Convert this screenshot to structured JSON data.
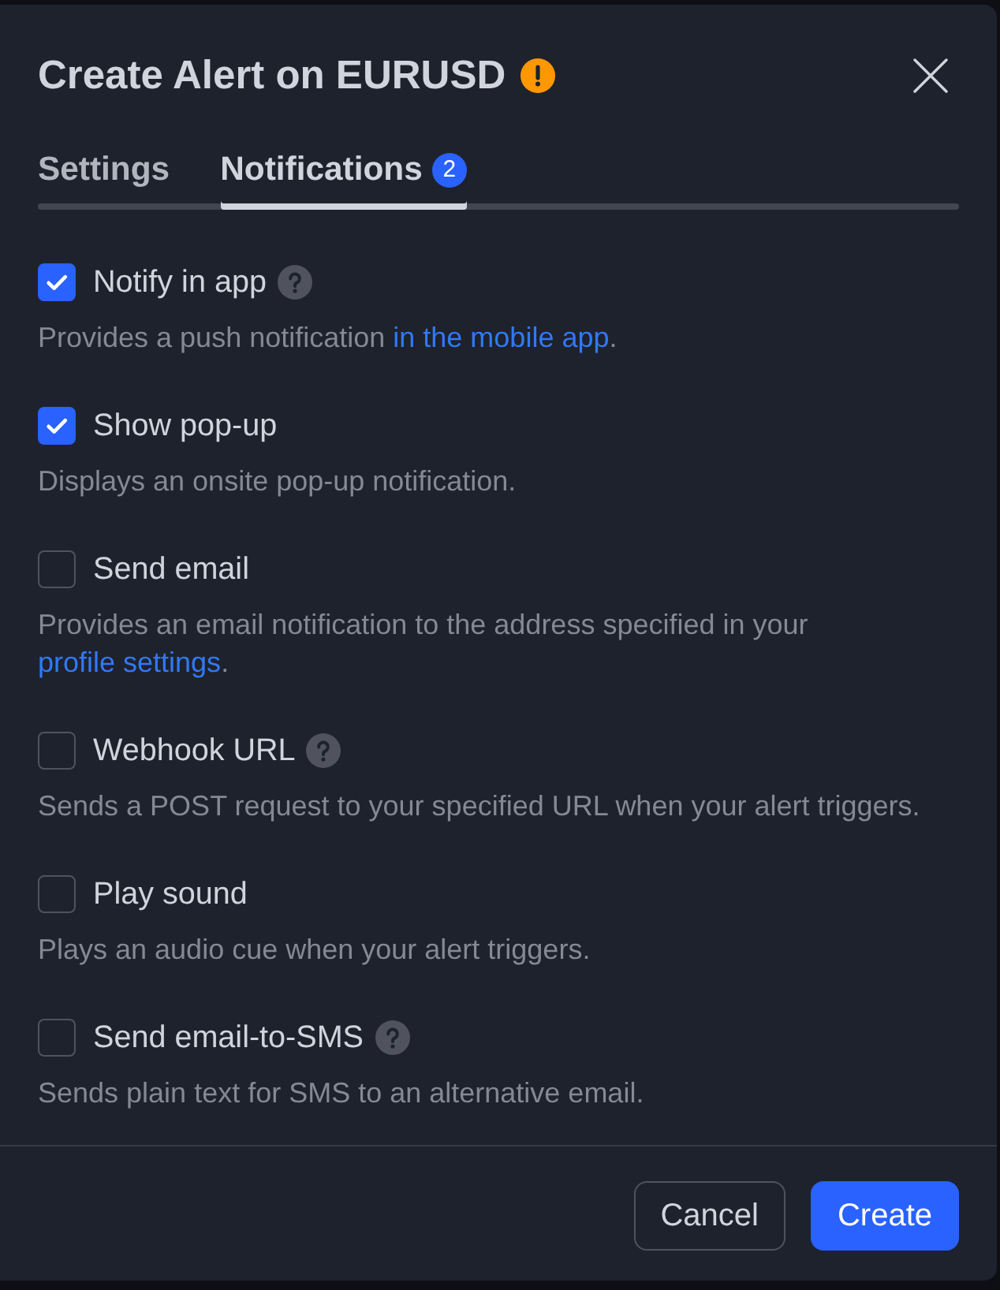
{
  "dialog": {
    "title": "Create Alert on EURUSD"
  },
  "tabs": [
    {
      "label": "Settings",
      "selected": false
    },
    {
      "label": "Notifications",
      "selected": true,
      "badge": "2"
    }
  ],
  "options": [
    {
      "label": "Notify in app",
      "checked": true,
      "help": true,
      "description": [
        {
          "kind": "text",
          "text": "Provides a push notification "
        },
        {
          "kind": "link",
          "text": "in the mobile app"
        },
        {
          "kind": "text",
          "text": "."
        }
      ]
    },
    {
      "label": "Show pop-up",
      "checked": true,
      "help": false,
      "description": [
        {
          "kind": "text",
          "text": "Displays an onsite pop-up notification."
        }
      ]
    },
    {
      "label": "Send email",
      "checked": false,
      "help": false,
      "description": [
        {
          "kind": "text",
          "text": "Provides an email notification to the address specified in your "
        },
        {
          "kind": "link",
          "text": "profile settings"
        },
        {
          "kind": "text",
          "text": "."
        }
      ]
    },
    {
      "label": "Webhook URL",
      "checked": false,
      "help": true,
      "description": [
        {
          "kind": "text",
          "text": "Sends a POST request to your specified URL when your alert triggers."
        }
      ]
    },
    {
      "label": "Play sound",
      "checked": false,
      "help": false,
      "description": [
        {
          "kind": "text",
          "text": "Plays an audio cue when your alert triggers."
        }
      ]
    },
    {
      "label": "Send email-to-SMS",
      "checked": false,
      "help": true,
      "description": [
        {
          "kind": "text",
          "text": "Sends plain text for SMS to an alternative email."
        }
      ]
    }
  ],
  "buttons": [
    {
      "label": "Cancel",
      "kind": "secondary"
    },
    {
      "label": "Create",
      "kind": "primary"
    }
  ]
}
